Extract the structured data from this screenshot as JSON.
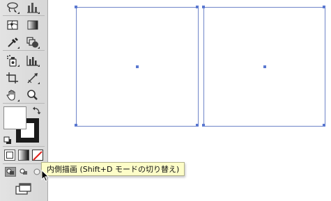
{
  "tooltip": {
    "text": "内側描画 (Shift+D モードの切り替え)"
  },
  "toolbar": {
    "rows": [
      {
        "left_tool": "lasso-icon",
        "right_tool": "graph-icon"
      },
      {
        "left_tool": "mesh-icon",
        "right_tool": "gradient-icon"
      },
      {
        "left_tool": "eyedropper-icon",
        "right_tool": "blend-icon"
      },
      {
        "left_tool": "symbol-sprayer-icon",
        "right_tool": "column-graph-icon"
      },
      {
        "left_tool": "artboard-icon",
        "right_tool": "slice-icon"
      },
      {
        "left_tool": "hand-icon",
        "right_tool": "zoom-icon"
      }
    ],
    "fill_color": "#ffffff",
    "stroke_color": "#1a1a1a",
    "draw_modes": [
      "draw-normal",
      "draw-behind",
      "draw-inside"
    ]
  },
  "colors": {
    "artboard_border": "#6f85c8",
    "selection_handle": "#5a78d0",
    "tooltip_bg": "#fdfdc8"
  }
}
